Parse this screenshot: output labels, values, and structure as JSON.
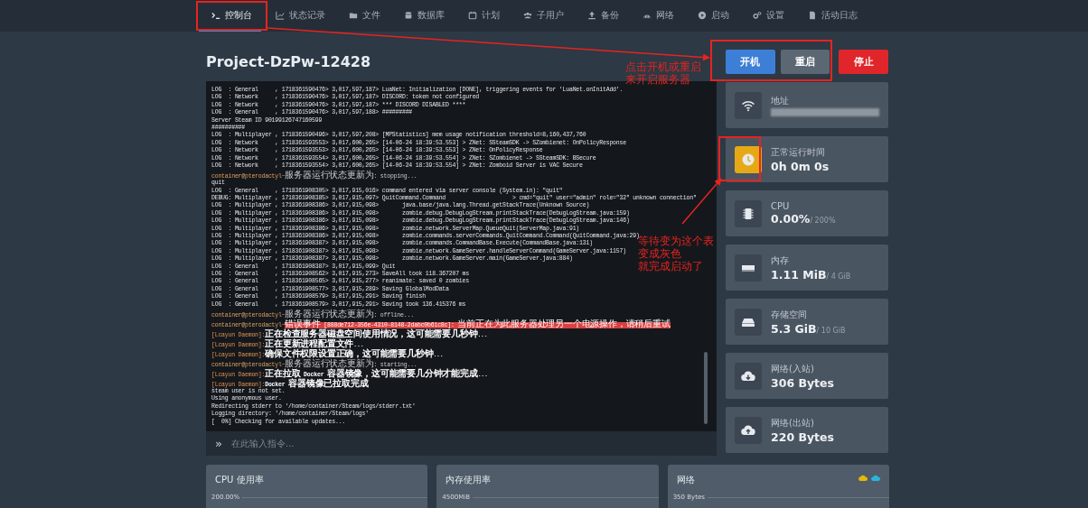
{
  "nav": [
    {
      "label": "控制台",
      "selected": true
    },
    {
      "label": "状态记录",
      "selected": false
    },
    {
      "label": "文件",
      "selected": false
    },
    {
      "label": "数据库",
      "selected": false
    },
    {
      "label": "计划",
      "selected": false
    },
    {
      "label": "子用户",
      "selected": false
    },
    {
      "label": "备份",
      "selected": false
    },
    {
      "label": "网络",
      "selected": false
    },
    {
      "label": "启动",
      "selected": false
    },
    {
      "label": "设置",
      "selected": false
    },
    {
      "label": "活动日志",
      "selected": false
    }
  ],
  "server_title": "Project-DzPw-12428",
  "power_buttons": [
    {
      "kind": "start",
      "label": "开机"
    },
    {
      "kind": "restart",
      "label": "重启"
    },
    {
      "kind": "stop",
      "label": "停止"
    }
  ],
  "console": {
    "lines": [
      {
        "kind": "log",
        "text": "LOG  : General     , 1718361590476> 3,017,597,187> LuaNet: Initialization [DONE], triggering events for 'LuaNet.onInitAdd'."
      },
      {
        "kind": "log",
        "text": "LOG  : Network     , 1718361590476> 3,017,597,187> DISCORD: token not configured"
      },
      {
        "kind": "log",
        "text": "LOG  : Network     , 1718361590476> 3,017,597,187> *** DISCORD DISABLED ****"
      },
      {
        "kind": "log",
        "text": "LOG  : General     , 1718361590476> 3,017,597,188> #########"
      },
      {
        "kind": "log",
        "text": "Server Steam ID 90199126747160599"
      },
      {
        "kind": "log",
        "text": "##########"
      },
      {
        "kind": "log",
        "text": "LOG  : Multiplayer , 1718361590496> 3,017,597,208> [MPStatistics] mem usage notification threshold=8,160,437,760"
      },
      {
        "kind": "log",
        "text": "LOG  : Network     , 1718361593553> 3,017,600,265> [14-06-24 18:39:53.553] > ZNet: SSteamSDK -> SZombienet: OnPolicyResponse"
      },
      {
        "kind": "log",
        "text": "LOG  : Network     , 1718361593553> 3,017,600,265> [14-06-24 18:39:53.553] > ZNet: OnPolicyResponse"
      },
      {
        "kind": "log",
        "text": "LOG  : Network     , 1718361593554> 3,017,600,265> [14-06-24 18:39:53.554] > ZNet: SZombienet -> SSteamSDK: BSecure"
      },
      {
        "kind": "log",
        "text": "LOG  : Network     , 1718361593554> 3,017,600,265> [14-06-24 18:39:53.554] > ZNet: Zomboid Server is VAC Secure"
      },
      {
        "kind": "prompt",
        "prefix": "container@pterodactyl~",
        "text": "服务器运行状态更新为: stopping..."
      },
      {
        "kind": "log",
        "text": "quit"
      },
      {
        "kind": "log",
        "text": "LOG  : General     , 1718361908305> 3,017,915,016> command entered via server console (System.in): \"quit\""
      },
      {
        "kind": "log",
        "text": "DEBUG: Multiplayer , 1718361908385> 3,017,915,097> QuitCommand.Command                    > cmd=\"quit\" user=\"admin\" role=\"32\" unknown connection\""
      },
      {
        "kind": "log",
        "text": "LOG  : Multiplayer , 1718361908386> 3,017,915,098>       java.base/java.lang.Thread.getStackTrace(Unknown Source)"
      },
      {
        "kind": "log",
        "text": "LOG  : Multiplayer , 1718361908386> 3,017,915,098>       zombie.debug.DebugLogStream.printStackTrace(DebugLogStream.java:159)"
      },
      {
        "kind": "log",
        "text": "LOG  : Multiplayer , 1718361908386> 3,017,915,098>       zombie.debug.DebugLogStream.printStackTrace(DebugLogStream.java:146)"
      },
      {
        "kind": "log",
        "text": "LOG  : Multiplayer , 1718361908386> 3,017,915,098>       zombie.network.ServerMap.QueueQuit(ServerMap.java:91)"
      },
      {
        "kind": "log",
        "text": "LOG  : Multiplayer , 1718361908386> 3,017,915,098>       zombie.commands.serverCommands.QuitCommand.Command(QuitCommand.java:29)"
      },
      {
        "kind": "log",
        "text": "LOG  : Multiplayer , 1718361908387> 3,017,915,098>       zombie.commands.CommandBase.Execute(CommandBase.java:131)"
      },
      {
        "kind": "log",
        "text": "LOG  : Multiplayer , 1718361908387> 3,017,915,098>       zombie.network.GameServer.handleServerCommand(GameServer.java:1157)"
      },
      {
        "kind": "log",
        "text": "LOG  : Multiplayer , 1718361908387> 3,017,915,098>       zombie.network.GameServer.main(GameServer.java:884)"
      },
      {
        "kind": "log",
        "text": "LOG  : General     , 1718361908387> 3,017,915,099> Quit"
      },
      {
        "kind": "log",
        "text": "LOG  : General     , 1718361908562> 3,017,915,273> SaveAll took 118.367207 ms"
      },
      {
        "kind": "log",
        "text": "LOG  : General     , 1718361908565> 3,017,915,277> reanimate: saved 0 zombies"
      },
      {
        "kind": "log",
        "text": "LOG  : General     , 1718361908577> 3,017,915,289> Saving GlobalModData"
      },
      {
        "kind": "log",
        "text": "LOG  : General     , 1718361908579> 3,017,915,291> Saving finish"
      },
      {
        "kind": "log",
        "text": "LOG  : General     , 1718361908579> 3,017,915,291> Saving took 136.415376 ms"
      },
      {
        "kind": "prompt",
        "prefix": "container@pterodactyl~",
        "text": "服务器运行状态更新为: offline..."
      },
      {
        "kind": "error",
        "prefix": "container@pterodactyl~",
        "text": "错误事件 [888de712-356e-4310-8148-2dabc0b61c8c]: 当前正在为此服务器处理另一个电源操作，请稍后重试"
      },
      {
        "kind": "daemon",
        "prefix": "[Lcayun Daemon]:",
        "text": "正在检查服务器磁盘空间使用情况，这可能需要几秒钟..."
      },
      {
        "kind": "daemon",
        "prefix": "[Lcayun Daemon]:",
        "text": "正在更新进程配置文件..."
      },
      {
        "kind": "daemon",
        "prefix": "[Lcayun Daemon]:",
        "text": "确保文件权限设置正确，这可能需要几秒钟..."
      },
      {
        "kind": "prompt",
        "prefix": "container@pterodactyl~",
        "text": "服务器运行状态更新为: starting..."
      },
      {
        "kind": "daemon",
        "prefix": "[Lcayun Daemon]:",
        "text": "正在拉取 Docker 容器镜像，这可能需要几分钟才能完成..."
      },
      {
        "kind": "daemon",
        "prefix": "[Lcayun Daemon]:",
        "text": "Docker 容器镜像已拉取完成"
      },
      {
        "kind": "log",
        "text": "steam user is not set."
      },
      {
        "kind": "log",
        "text": "Using anonymous user."
      },
      {
        "kind": "log",
        "text": "Redirecting stderr to '/home/container/Steam/logs/stderr.txt'"
      },
      {
        "kind": "log",
        "text": "Logging directory: '/home/container/Steam/logs'"
      },
      {
        "kind": "log",
        "text": "[  0%] Checking for available updates..."
      }
    ],
    "prompt_symbol": "»",
    "placeholder": "在此输入指令..."
  },
  "stats": [
    {
      "label": "地址",
      "highlighted": false
    },
    {
      "label": "正常运行时间",
      "value": "0h 0m 0s",
      "highlighted": true
    },
    {
      "label": "CPU",
      "value": "0.00%",
      "limit": "/ 200%",
      "highlighted": false
    },
    {
      "label": "内存",
      "value": "1.11 MiB",
      "limit": "/ 4 GiB",
      "highlighted": false
    },
    {
      "label": "存储空间",
      "value": "5.3 GiB",
      "limit": "/ 10 GiB",
      "highlighted": false
    },
    {
      "label": "网络(入站)",
      "value": "306 Bytes",
      "highlighted": false
    },
    {
      "label": "网络(出站)",
      "value": "220 Bytes",
      "highlighted": false
    }
  ],
  "graphs": [
    {
      "title": "CPU 使用率",
      "axis_label": "200.00%",
      "legend": false
    },
    {
      "title": "内存使用率",
      "axis_label": "4500MiB",
      "legend": false
    },
    {
      "title": "网络",
      "axis_label": "350 Bytes",
      "legend": true
    }
  ],
  "annotations": [
    {
      "lines": [
        "点击开机或重启",
        "来开启服务器"
      ]
    },
    {
      "lines": [
        "等待变为这个表",
        "变成灰色",
        "就完成启动了"
      ]
    }
  ]
}
